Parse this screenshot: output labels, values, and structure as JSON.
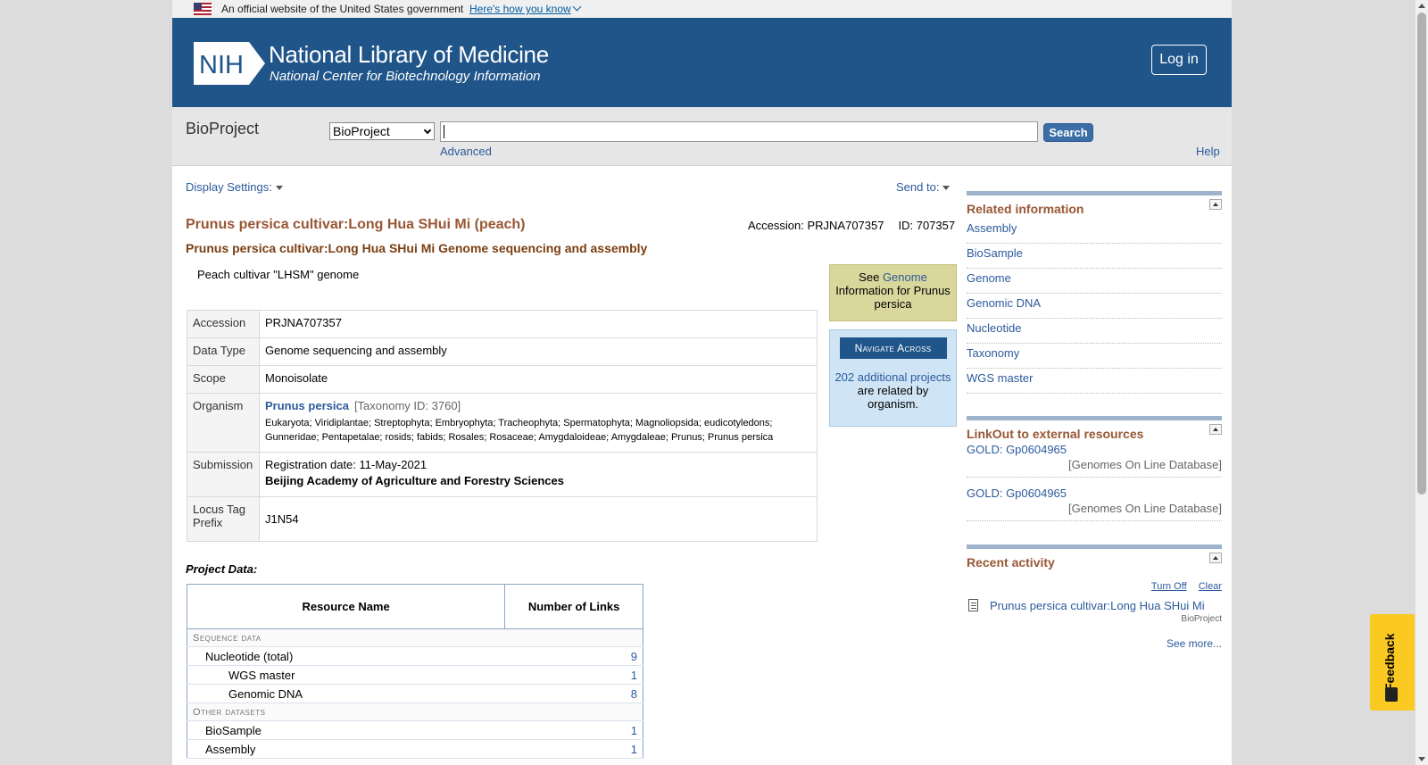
{
  "gov_banner": {
    "text": "An official website of the United States government",
    "link": "Here's how you know"
  },
  "header": {
    "logo_text": "NIH",
    "title": "National Library of Medicine",
    "subtitle": "National Center for Biotechnology Information",
    "login": "Log in"
  },
  "search": {
    "db_name": "BioProject",
    "db_selected": "BioProject",
    "value": "",
    "button": "Search",
    "advanced": "Advanced",
    "help": "Help"
  },
  "toolbar": {
    "display_settings": "Display Settings:",
    "send_to": "Send to:"
  },
  "record": {
    "title": "Prunus persica cultivar:Long Hua SHui Mi (peach)",
    "accession_line": "Accession: PRJNA707357",
    "id_line": "ID: 707357",
    "subtitle": "Prunus persica cultivar:Long Hua SHui Mi Genome sequencing and assembly",
    "description": "Peach cultivar \"LHSM\" genome",
    "rows": {
      "accession": {
        "label": "Accession",
        "value": "PRJNA707357"
      },
      "data_type": {
        "label": "Data Type",
        "value": "Genome sequencing and assembly"
      },
      "scope": {
        "label": "Scope",
        "value": "Monoisolate"
      },
      "organism": {
        "label": "Organism",
        "name": "Prunus persica",
        "taxid": "[Taxonomy ID: 3760]",
        "lineage": "Eukaryota; Viridiplantae; Streptophyta; Embryophyta; Tracheophyta; Spermatophyta; Magnoliopsida; eudicotyledons; Gunneridae; Pentapetalae; rosids; fabids; Rosales; Rosaceae; Amygdaloideae; Amygdaleae; Prunus; Prunus persica"
      },
      "submission": {
        "label": "Submission",
        "date": "Registration date: 11-May-2021",
        "org": "Beijing Academy of Agriculture and Forestry Sciences"
      },
      "locus": {
        "label": "Locus Tag Prefix",
        "value": "J1N54"
      }
    }
  },
  "project_data": {
    "label": "Project Data:",
    "col_resource": "Resource Name",
    "col_links": "Number of Links",
    "sections": [
      {
        "category": "Sequence data",
        "rows": [
          {
            "name": "Nucleotide (total)",
            "count": "9",
            "level": 1
          },
          {
            "name": "WGS master",
            "count": "1",
            "level": 2
          },
          {
            "name": "Genomic DNA",
            "count": "8",
            "level": 2
          }
        ]
      },
      {
        "category": "Other datasets",
        "rows": [
          {
            "name": "BioSample",
            "count": "1",
            "level": 1
          },
          {
            "name": "Assembly",
            "count": "1",
            "level": 1
          }
        ]
      }
    ]
  },
  "genome_box": {
    "see": "See",
    "link": "Genome",
    "text": "Information for Prunus persica"
  },
  "nav_box": {
    "button": "Navigate Across",
    "link": "202 additional projects",
    "text": "are related by organism."
  },
  "related": {
    "title": "Related information",
    "items": [
      "Assembly",
      "BioSample",
      "Genome",
      "Genomic DNA",
      "Nucleotide",
      "Taxonomy",
      "WGS master"
    ]
  },
  "linkout": {
    "title": "LinkOut to external resources",
    "items": [
      {
        "name": "GOLD: Gp0604965",
        "source": "[Genomes On Line Database]"
      },
      {
        "name": "GOLD: Gp0604965",
        "source": "[Genomes On Line Database]"
      }
    ]
  },
  "recent": {
    "title": "Recent activity",
    "turn_off": "Turn Off",
    "clear": "Clear",
    "item": "Prunus persica cultivar:Long Hua SHui Mi",
    "item_db": "BioProject",
    "see_more": "See more..."
  },
  "feedback": {
    "label": "Feedback"
  },
  "colors": {
    "header_blue": "#20558a",
    "title_brown": "#985735",
    "link_blue": "#2b5a9c",
    "feedback_yellow": "#fac922"
  }
}
